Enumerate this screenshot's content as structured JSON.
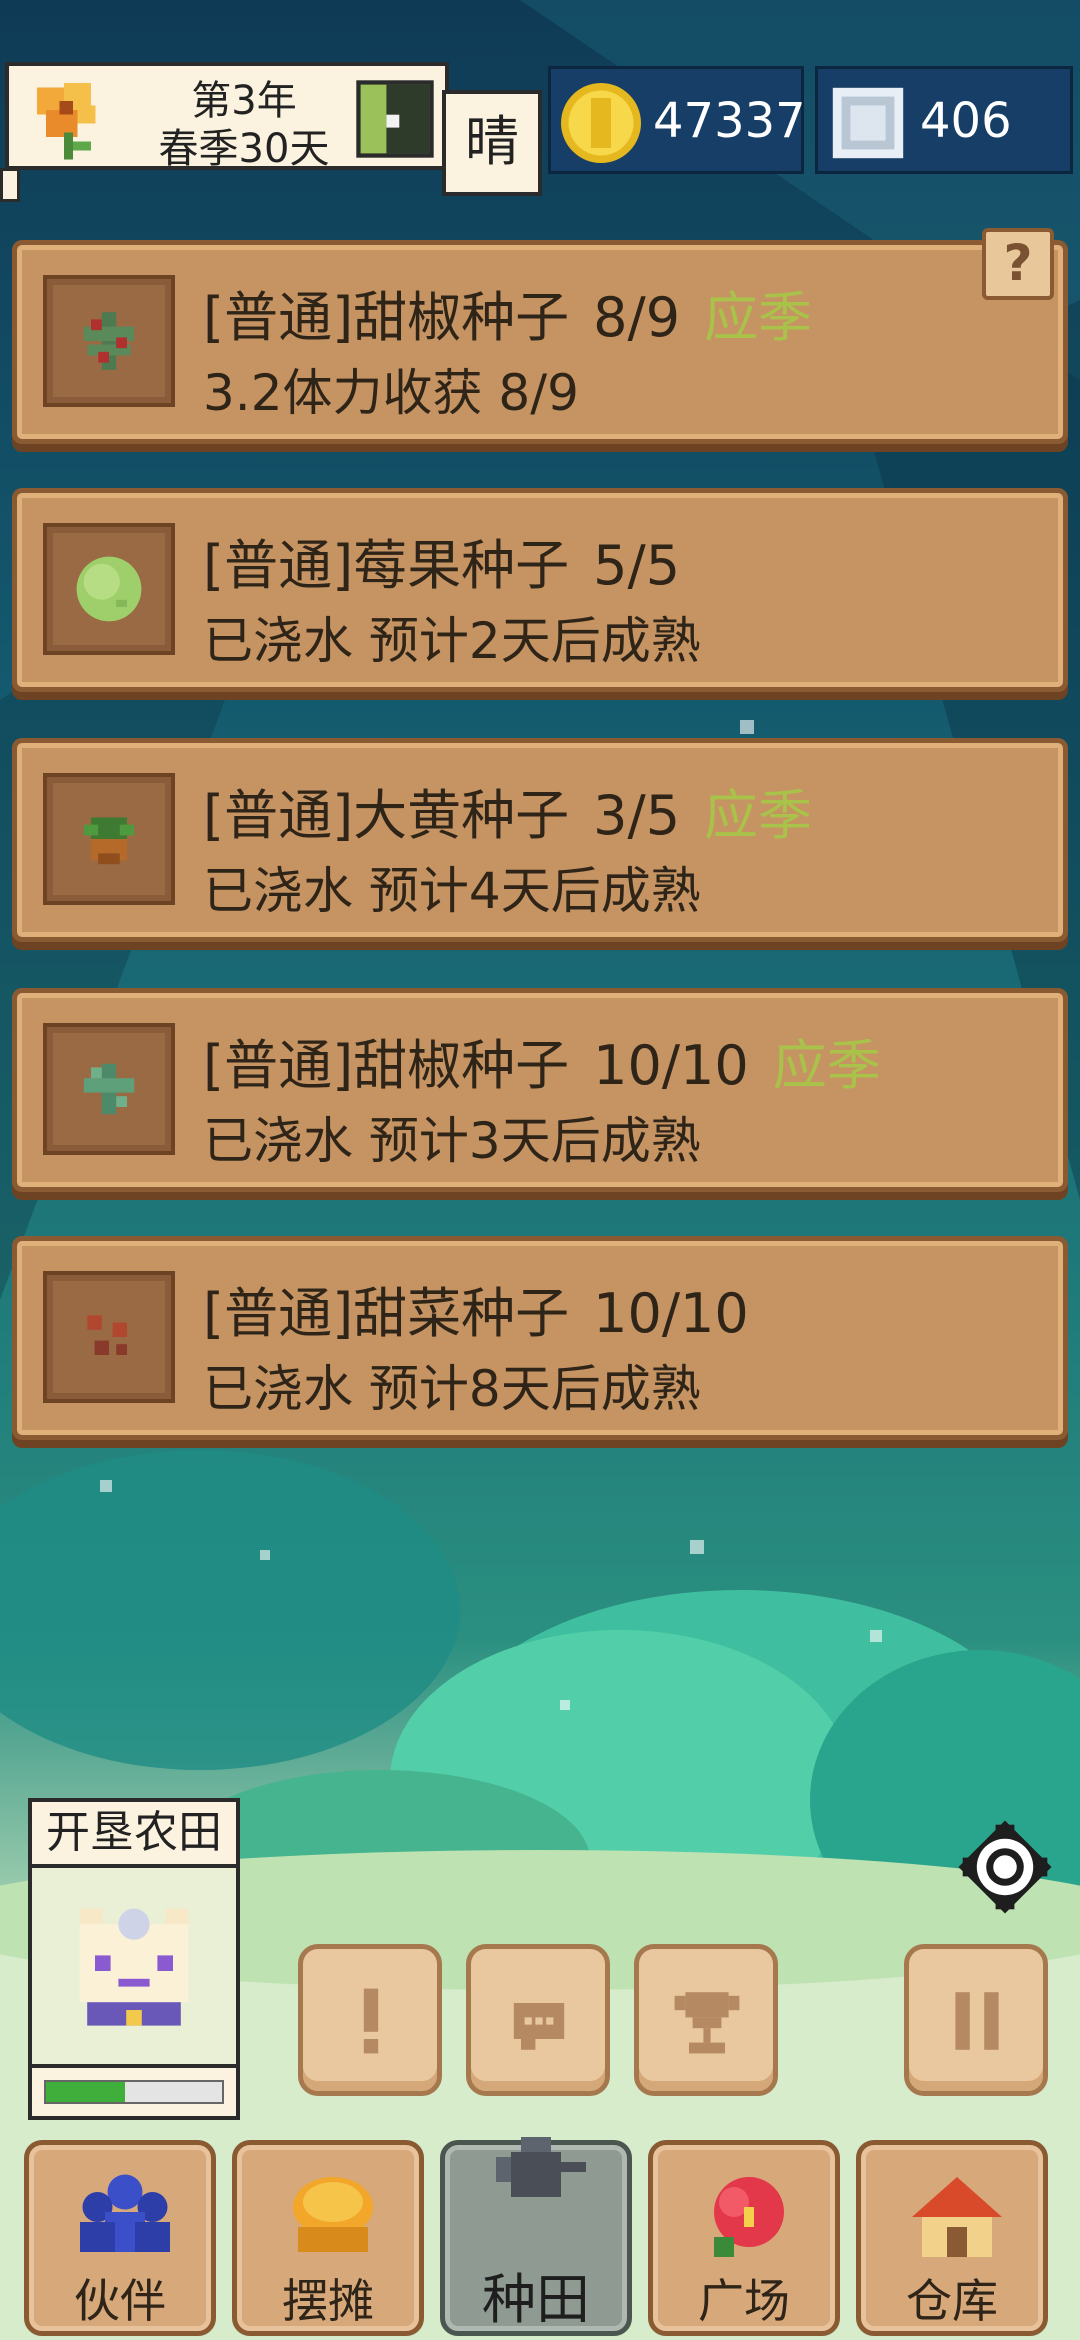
{
  "status_bar": {
    "year": "第3年",
    "season_day": "春季30天",
    "weather": "晴",
    "coins": "47337",
    "gems": "406"
  },
  "help_label": "?",
  "seed_cards": [
    {
      "name": "[普通]甜椒种子",
      "count": "8/9",
      "tag": "应季",
      "status": "3.2体力收获 8/9",
      "plant_color": "#5a8a5a",
      "fruit_color": "#b03030"
    },
    {
      "name": "[普通]莓果种子",
      "count": "5/5",
      "tag": "",
      "status": "已浇水 预计2天后成熟",
      "plant_color": "#9fcf6a",
      "fruit_color": "#9fcf6a"
    },
    {
      "name": "[普通]大黄种子",
      "count": "3/5",
      "tag": "应季",
      "status": "已浇水 预计4天后成熟",
      "plant_color": "#3f7a32",
      "fruit_color": "#b56a2a"
    },
    {
      "name": "[普通]甜椒种子",
      "count": "10/10",
      "tag": "应季",
      "status": "已浇水 预计3天后成熟",
      "plant_color": "#4e8a6a",
      "fruit_color": "#4e8a6a"
    },
    {
      "name": "[普通]甜菜种子",
      "count": "10/10",
      "tag": "",
      "status": "已浇水 预计8天后成熟",
      "plant_color": "#8a3a2a",
      "fruit_color": "#b0472e"
    }
  ],
  "companion": {
    "task_label": "开垦农田",
    "progress": 0.45
  },
  "nav": [
    {
      "label": "伙伴",
      "icon": "people-icon"
    },
    {
      "label": "摆摊",
      "icon": "stall-icon"
    },
    {
      "label": "种田",
      "icon": "watering-can-icon"
    },
    {
      "label": "广场",
      "icon": "flower-icon"
    },
    {
      "label": "仓库",
      "icon": "house-icon"
    }
  ],
  "colors": {
    "tag_color": "#a9c24a",
    "card_bg": "#c69463",
    "currency_bg": "#163e66"
  }
}
